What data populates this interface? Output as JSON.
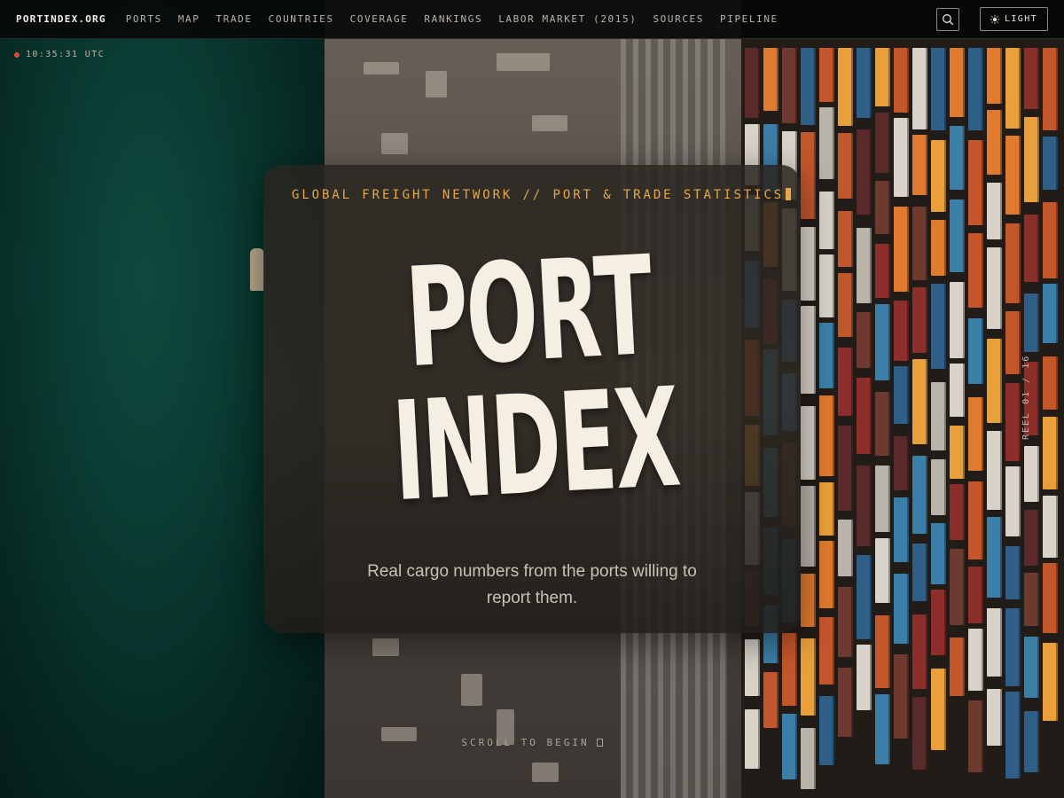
{
  "brand": {
    "logo": "PORTINDEX.ORG"
  },
  "nav": {
    "items": [
      "PORTS",
      "MAP",
      "TRADE",
      "COUNTRIES",
      "COVERAGE",
      "RANKINGS",
      "LABOR MARKET (2015)",
      "SOURCES",
      "PIPELINE"
    ]
  },
  "toolbar": {
    "search_icon": "search-icon",
    "theme_label": "LIGHT",
    "theme_icon": "sun-icon"
  },
  "status": {
    "clock": "10:35:31 UTC",
    "live_color": "#e34a3b"
  },
  "hero": {
    "kicker": "GLOBAL FREIGHT NETWORK // PORT & TRADE STATISTICS",
    "title_line1": "PORT",
    "title_line2": "INDEX",
    "tagline": "Real cargo numbers from the ports willing to report them."
  },
  "reel": {
    "label": "REEL 01 / 16"
  },
  "scroll": {
    "label": "SCROLL TO BEGIN",
    "icon": "mouse-icon"
  },
  "colors": {
    "accent": "#e7a74a",
    "title": "#f4efe2",
    "sea": "#0a3b32"
  }
}
